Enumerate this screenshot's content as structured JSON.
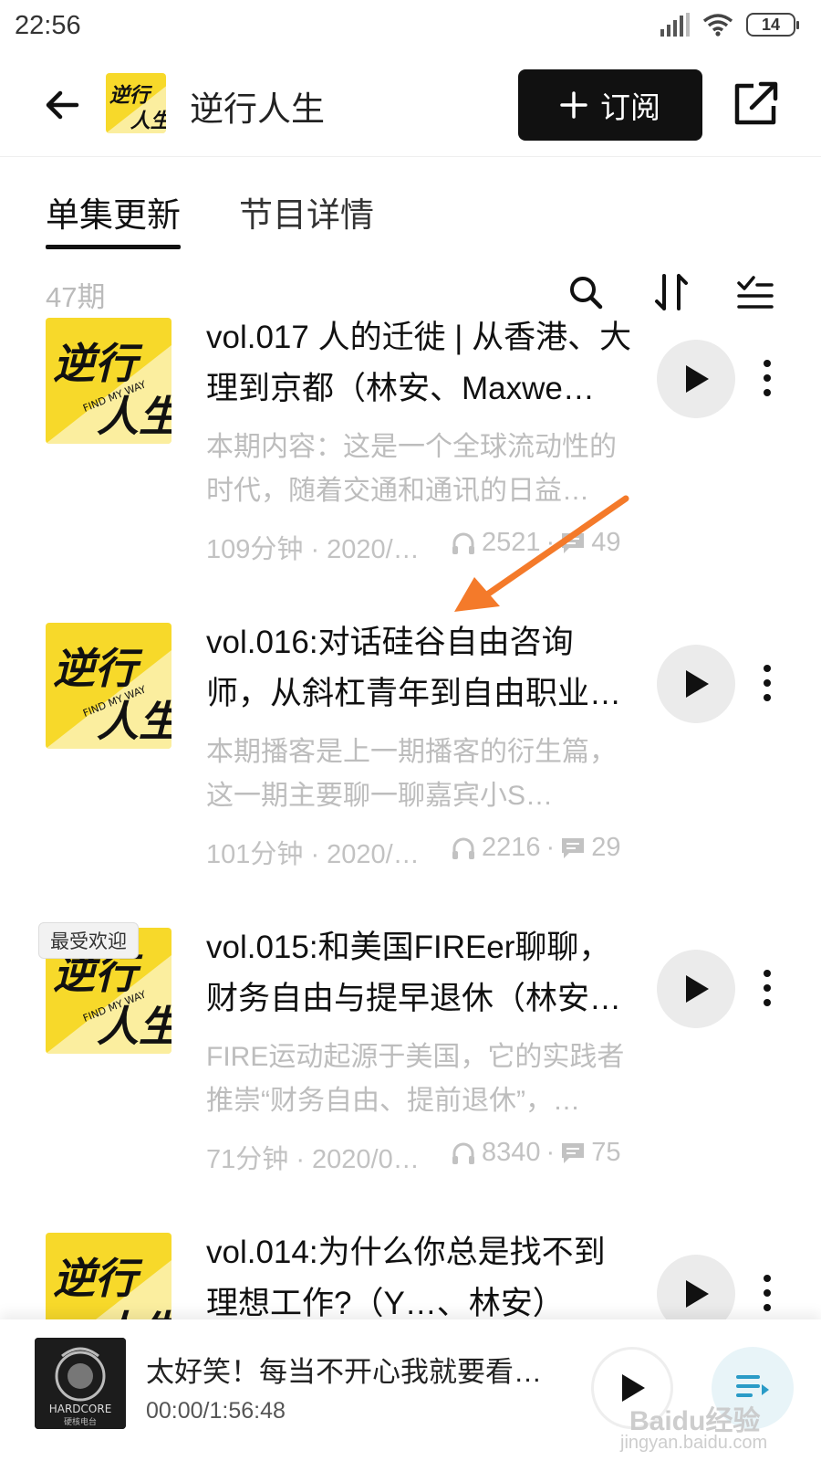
{
  "status_bar": {
    "time": "22:56",
    "battery": "14"
  },
  "header": {
    "podcast_title": "逆行人生",
    "subscribe_label": "订阅"
  },
  "tabs": [
    {
      "label": "单集更新",
      "active": true
    },
    {
      "label": "节目详情",
      "active": false
    }
  ],
  "toolbar": {
    "episode_count": "47期"
  },
  "cover_art": {
    "main_text": "逆行",
    "sub_text": "人生",
    "tagline": "FIND MY WAY",
    "accent_color": "#F7D92A"
  },
  "episodes": [
    {
      "title": "vol.017 人的迁徙 | 从香港、大理到京都（林安、Maxwe…",
      "description": "本期内容：这是一个全球流动性的时代，随着交通和通讯的日益…",
      "duration_date": "109分钟 · 2020/…",
      "plays": "2521",
      "comments": "49",
      "badge": ""
    },
    {
      "title": "vol.016:对话硅谷自由咨询师，从斜杠青年到自由职业…",
      "description": "本期播客是上一期播客的衍生篇，这一期主要聊一聊嘉宾小S…",
      "duration_date": "101分钟 · 2020/…",
      "plays": "2216",
      "comments": "29",
      "badge": ""
    },
    {
      "title": "vol.015:和美国FIREer聊聊，财务自由与提早退休（林安…",
      "description": "FIRE运动起源于美国，它的实践者推崇“财务自由、提前退休”，…",
      "duration_date": "71分钟 · 2020/0…",
      "plays": "8340",
      "comments": "75",
      "badge": "最受欢迎"
    },
    {
      "title": "vol.014:为什么你总是找不到理想工作?（Y…、林安）",
      "description": "",
      "duration_date": "",
      "plays": "",
      "comments": "",
      "badge": ""
    }
  ],
  "player": {
    "title": "太好笑！每当不开心我就要看…",
    "time": "00:00/1:56:48",
    "cover_text": "HARDCORE",
    "cover_sub": "硬核电台"
  },
  "watermark": {
    "brand": "Baidu经验",
    "url": "jingyan.baidu.com"
  },
  "annotation": {
    "arrow_color": "#F47A2A"
  }
}
